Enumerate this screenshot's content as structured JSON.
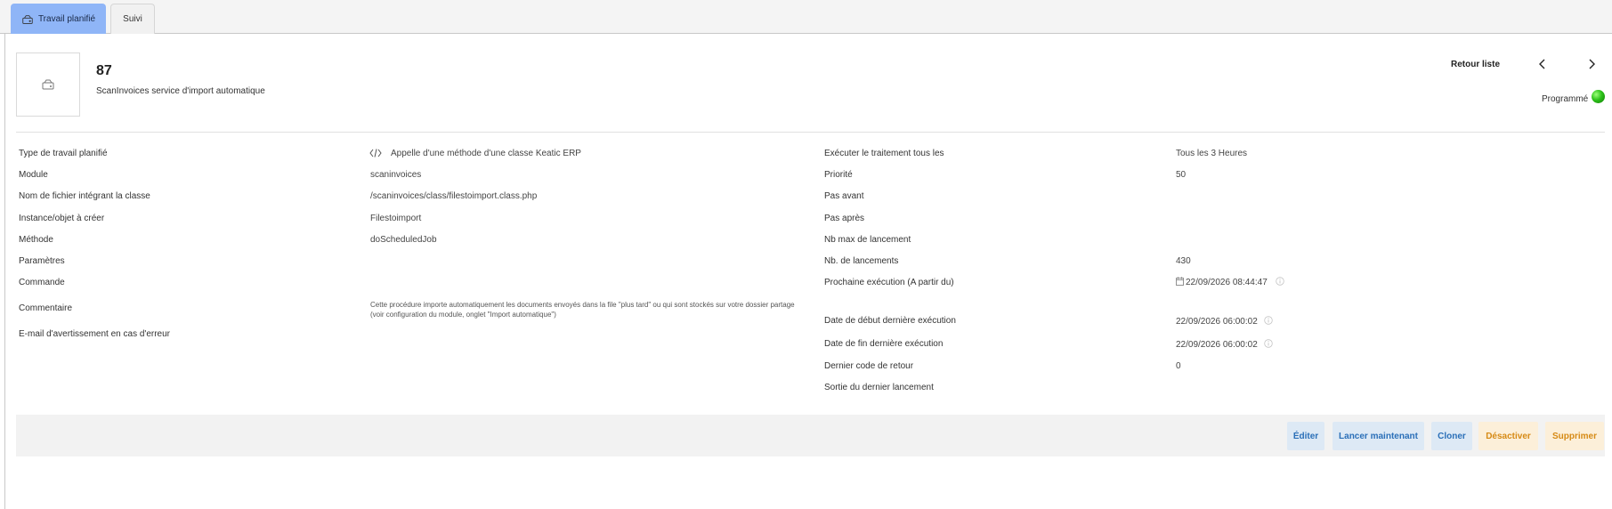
{
  "tabs": [
    {
      "label": "Travail planifié",
      "active": true
    },
    {
      "label": "Suivi",
      "active": false
    }
  ],
  "header": {
    "ref": "87",
    "label": "ScanInvoices service d'import automatique",
    "back_to_list": "Retour liste",
    "status": "Programmé"
  },
  "left_fields": [
    {
      "label": "Type de travail planifié",
      "value": "Appelle d'une méthode d'une classe Keatic ERP"
    },
    {
      "label": "Module",
      "value": "scaninvoices"
    },
    {
      "label": "Nom de fichier intégrant la classe",
      "value": "/scaninvoices/class/filestoimport.class.php"
    },
    {
      "label": "Instance/objet à créer",
      "value": "Filestoimport"
    },
    {
      "label": "Méthode",
      "value": "doScheduledJob"
    },
    {
      "label": "Paramètres",
      "value": ""
    },
    {
      "label": "Commande",
      "value": ""
    },
    {
      "label": "Commentaire",
      "value": "Cette procédure importe automatiquement les documents envoyés dans la file \"plus tard\" ou qui sont stockés sur votre dossier partage (voir configuration du module, onglet \"Import automatique\")"
    },
    {
      "label": "E-mail d'avertissement en cas d'erreur",
      "value": ""
    }
  ],
  "right_fields": [
    {
      "label": "Exécuter le traitement tous les",
      "value": "Tous les 3 Heures"
    },
    {
      "label": "Priorité",
      "value": "50"
    },
    {
      "label": "Pas avant",
      "value": ""
    },
    {
      "label": "Pas après",
      "value": ""
    },
    {
      "label": "Nb max de lancement",
      "value": ""
    },
    {
      "label": "Nb. de lancements",
      "value": "430"
    },
    {
      "label": "Prochaine exécution (A partir du)",
      "value": "22/09/2026 08:44:47"
    },
    {
      "label": "Date de début dernière exécution",
      "value": "22/09/2026 06:00:02"
    },
    {
      "label": "Date de fin dernière exécution",
      "value": "22/09/2026 06:00:02"
    },
    {
      "label": "Dernier code de retour",
      "value": "0"
    },
    {
      "label": "Sortie du dernier lancement",
      "value": ""
    }
  ],
  "actions": {
    "edit": "Éditer",
    "run_now": "Lancer maintenant",
    "clone": "Cloner",
    "disable": "Désactiver",
    "delete": "Supprimer"
  },
  "colors": {
    "active_tab": "#8fb5f7",
    "blue_button_text": "#2a6fb8",
    "orange_button_text": "#d68a15",
    "status_green": "#2dc21a"
  },
  "icons": {
    "tab": "cron-job-icon",
    "thumb": "cron-job-icon",
    "code": "code-icon",
    "calendar": "calendar-icon",
    "info": "info-icon"
  }
}
